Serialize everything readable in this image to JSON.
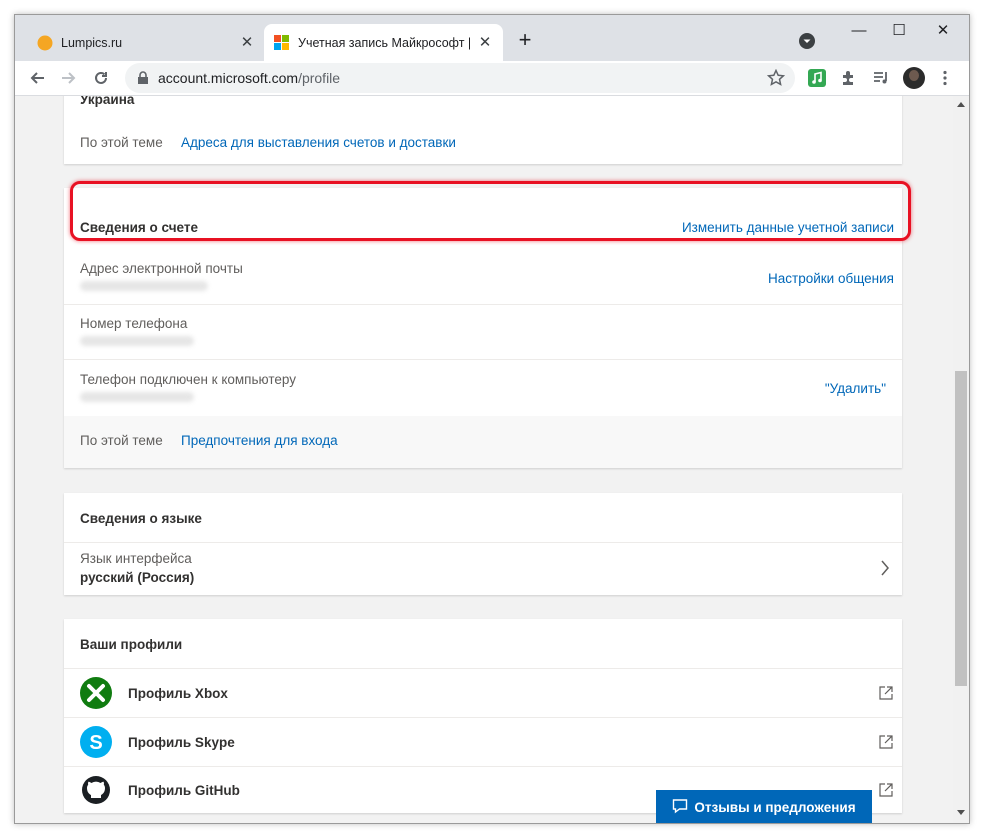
{
  "browser": {
    "tabs": [
      {
        "title": "Lumpics.ru",
        "active": false
      },
      {
        "title": "Учетная запись Майкрософт | Ya",
        "active": true
      }
    ],
    "url_domain": "account.microsoft.com",
    "url_path": "/profile"
  },
  "address_card": {
    "country": "Украина",
    "related_label": "По этой теме",
    "related_link": "Адреса для выставления счетов и доставки"
  },
  "account_info": {
    "title": "Сведения о счете",
    "edit_link": "Изменить данные учетной записи",
    "email_label": "Адрес электронной почты",
    "comm_settings_link": "Настройки общения",
    "phone_label": "Номер телефона",
    "connected_phone_label": "Телефон подключен к компьютеру",
    "remove_link": "\"Удалить\"",
    "related_label": "По этой теме",
    "related_link": "Предпочтения для входа"
  },
  "language_info": {
    "title": "Сведения о языке",
    "ui_language_label": "Язык интерфейса",
    "ui_language_value": "русский (Россия)"
  },
  "profiles": {
    "title": "Ваши профили",
    "items": [
      {
        "label": "Профиль Xbox",
        "icon": "xbox-icon",
        "color": "#107c10"
      },
      {
        "label": "Профиль Skype",
        "icon": "skype-icon",
        "color": "#00aff0"
      },
      {
        "label": "Профиль GitHub",
        "icon": "github-icon",
        "color": "#1b1f23"
      }
    ]
  },
  "feedback_button": "Отзывы и предложения",
  "colors": {
    "accent": "#0067b8",
    "highlight": "#e81123"
  }
}
